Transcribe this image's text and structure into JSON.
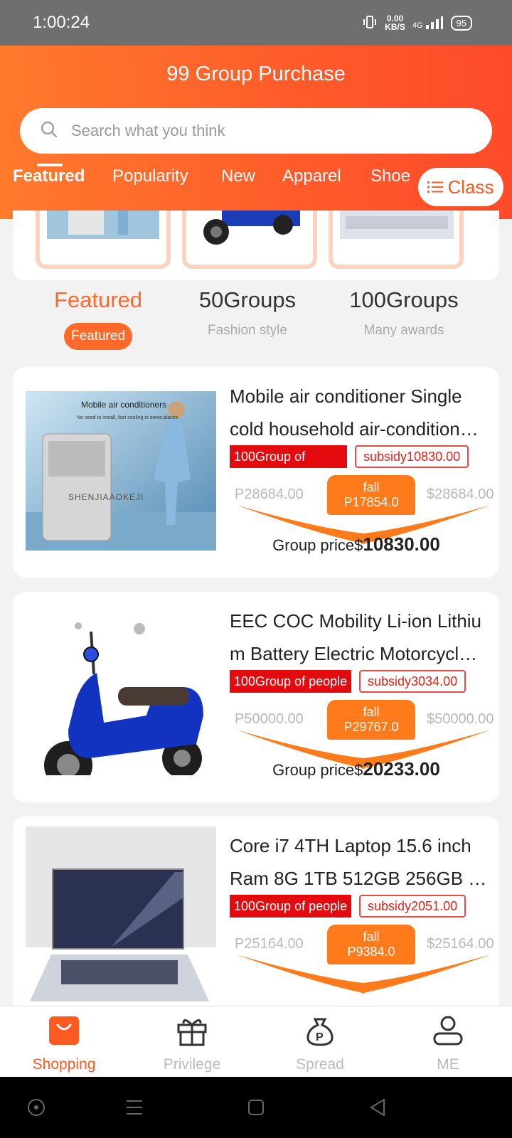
{
  "status": {
    "time": "1:00:24",
    "speed": "0.00",
    "speed_unit": "KB/S",
    "network": "4G",
    "battery": "95"
  },
  "header": {
    "title": "99 Group Purchase",
    "search_placeholder": "Search what you think",
    "class_button": "Class"
  },
  "tabs": [
    {
      "label": "Featured"
    },
    {
      "label": "Popularity"
    },
    {
      "label": "New"
    },
    {
      "label": "Apparel"
    },
    {
      "label": "Shoe"
    }
  ],
  "groups": [
    {
      "title": "Featured",
      "sub": "Featured"
    },
    {
      "title": "50Groups",
      "sub": "Fashion style"
    },
    {
      "title": "100Groups",
      "sub": "Many awards"
    }
  ],
  "products": [
    {
      "line1": "Mobile air conditioner Single",
      "line2": "cold household air-conditioner…",
      "badge": "100Group of",
      "subsidy": "subsidy10830.00",
      "left_price": "P28684.00",
      "right_price": "$28684.00",
      "fall_label": "fall",
      "fall_value": "P17854.0",
      "group_label": "Group price$",
      "group_price": "10830.00",
      "pic_caption": "Mobile air conditioners",
      "pic_subcaption": "No need to install, fast cooling in some places",
      "pic_watermark": "SHENJIAAOKEJI"
    },
    {
      "line1": "EEC COC Mobility Li-ion Lithiu",
      "line2": "m Battery Electric Motorcycle…",
      "badge": "100Group of people",
      "subsidy": "subsidy3034.00",
      "left_price": "P50000.00",
      "right_price": "$50000.00",
      "fall_label": "fall",
      "fall_value": "P29767.0",
      "group_label": "Group price$",
      "group_price": "20233.00"
    },
    {
      "line1": "Core i7 4TH Laptop 15.6 inch",
      "line2": "Ram 8G 1TB 512GB 256GB …",
      "badge": "100Group of people",
      "subsidy": "subsidy2051.00",
      "left_price": "P25164.00",
      "right_price": "$25164.00",
      "fall_label": "fall",
      "fall_value": "P9384.0",
      "group_label": "",
      "group_price": ""
    }
  ],
  "bottom_nav": [
    {
      "label": "Shopping",
      "icon": "shopping-bag-icon"
    },
    {
      "label": "Privilege",
      "icon": "gift-icon"
    },
    {
      "label": "Spread",
      "icon": "money-bag-icon"
    },
    {
      "label": "ME",
      "icon": "person-icon"
    }
  ],
  "colors": {
    "brand": "#ff5a22",
    "badge_red": "#e40b10",
    "fall_orange": "#ff7a1b"
  }
}
